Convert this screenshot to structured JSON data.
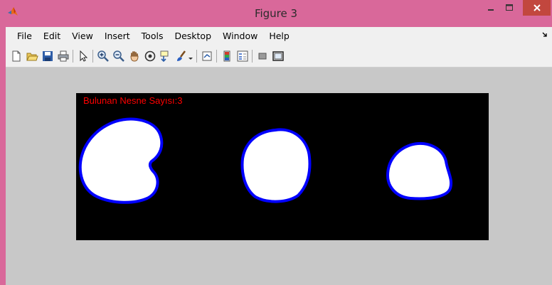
{
  "window": {
    "title": "Figure 3",
    "icons": {
      "app": "matlab-icon",
      "minimize": "minimize-icon",
      "maximize": "maximize-icon",
      "close": "close-icon"
    }
  },
  "menubar": {
    "items": [
      {
        "label": "File"
      },
      {
        "label": "Edit"
      },
      {
        "label": "View"
      },
      {
        "label": "Insert"
      },
      {
        "label": "Tools"
      },
      {
        "label": "Desktop"
      },
      {
        "label": "Window"
      },
      {
        "label": "Help"
      }
    ],
    "overflow_icon": "dock-arrow-icon"
  },
  "toolbar": {
    "buttons": [
      "new-figure",
      "open-file",
      "save-figure",
      "print-figure",
      "edit-plot",
      "zoom-in",
      "zoom-out",
      "pan",
      "rotate-3d",
      "data-cursor",
      "brush",
      "link-plot",
      "insert-colorbar",
      "insert-legend",
      "hide-plot-tools",
      "show-plot-tools"
    ]
  },
  "figure": {
    "annotation": "Bulunan Nesne Sayısı:3",
    "annotation_color": "#ff0000",
    "background": "#000000",
    "object_fill": "#ffffff",
    "object_outline": "#0000ff",
    "object_count": 3
  }
}
